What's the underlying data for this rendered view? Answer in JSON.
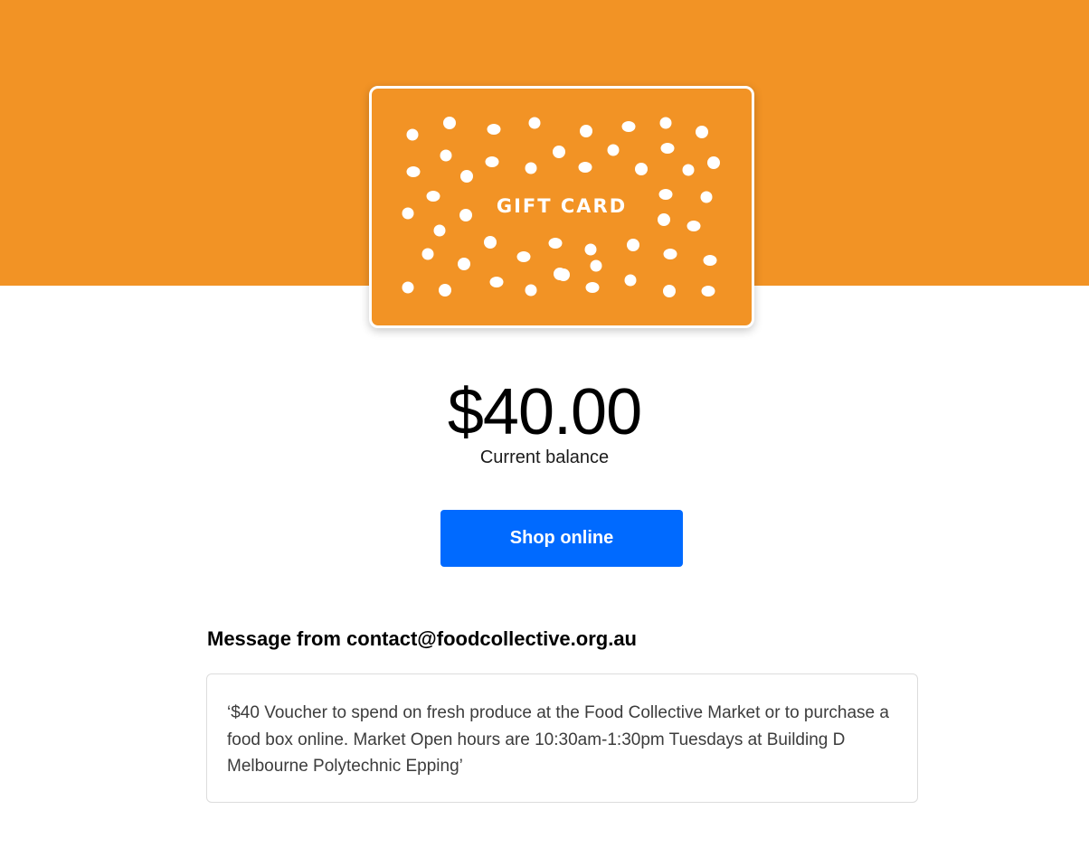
{
  "hero": {
    "background_color": "#f29325"
  },
  "gift_card": {
    "title": "GIFT CARD",
    "card_color": "#f29325",
    "dot_color": "#ffffff"
  },
  "balance": {
    "amount": "$40.00",
    "label": "Current balance"
  },
  "actions": {
    "shop_label": "Shop online",
    "button_color": "#006aff"
  },
  "message": {
    "heading": "Message from contact@foodcollective.org.au",
    "body": "‘$40 Voucher to spend on fresh produce at the Food Collective Market or to purchase a food box online. Market Open hours are 10:30am-1:30pm Tuesdays at Building D Melbourne Polytechnic Epping’"
  }
}
